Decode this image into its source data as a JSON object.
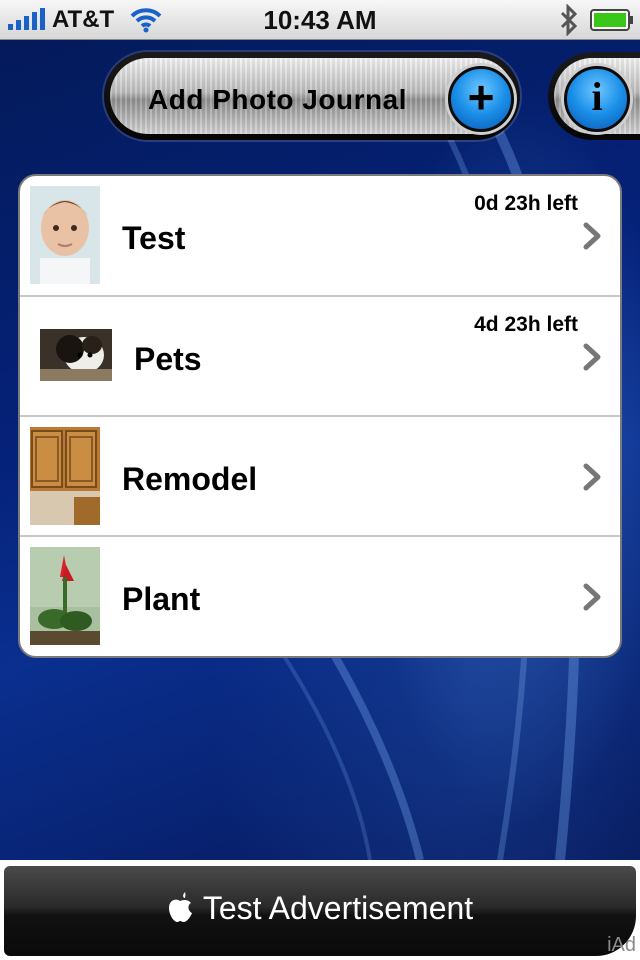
{
  "status_bar": {
    "carrier": "AT&T",
    "time": "10:43 AM",
    "icons": [
      "signal-bars-icon",
      "wifi-icon",
      "bluetooth-icon",
      "battery-icon"
    ]
  },
  "toolbar": {
    "add_label": "Add Photo Journal",
    "add_icon": "plus-icon",
    "info_icon": "info-icon"
  },
  "journals": [
    {
      "title": "Test",
      "time_left": "0d 23h left"
    },
    {
      "title": "Pets",
      "time_left": "4d 23h left"
    },
    {
      "title": "Remodel",
      "time_left": ""
    },
    {
      "title": "Plant",
      "time_left": ""
    }
  ],
  "ad": {
    "text": "Test Advertisement",
    "badge": "iAd",
    "icon": "apple-logo"
  },
  "colors": {
    "accent_blue": "#1a8fe8",
    "background": "#03164a"
  }
}
